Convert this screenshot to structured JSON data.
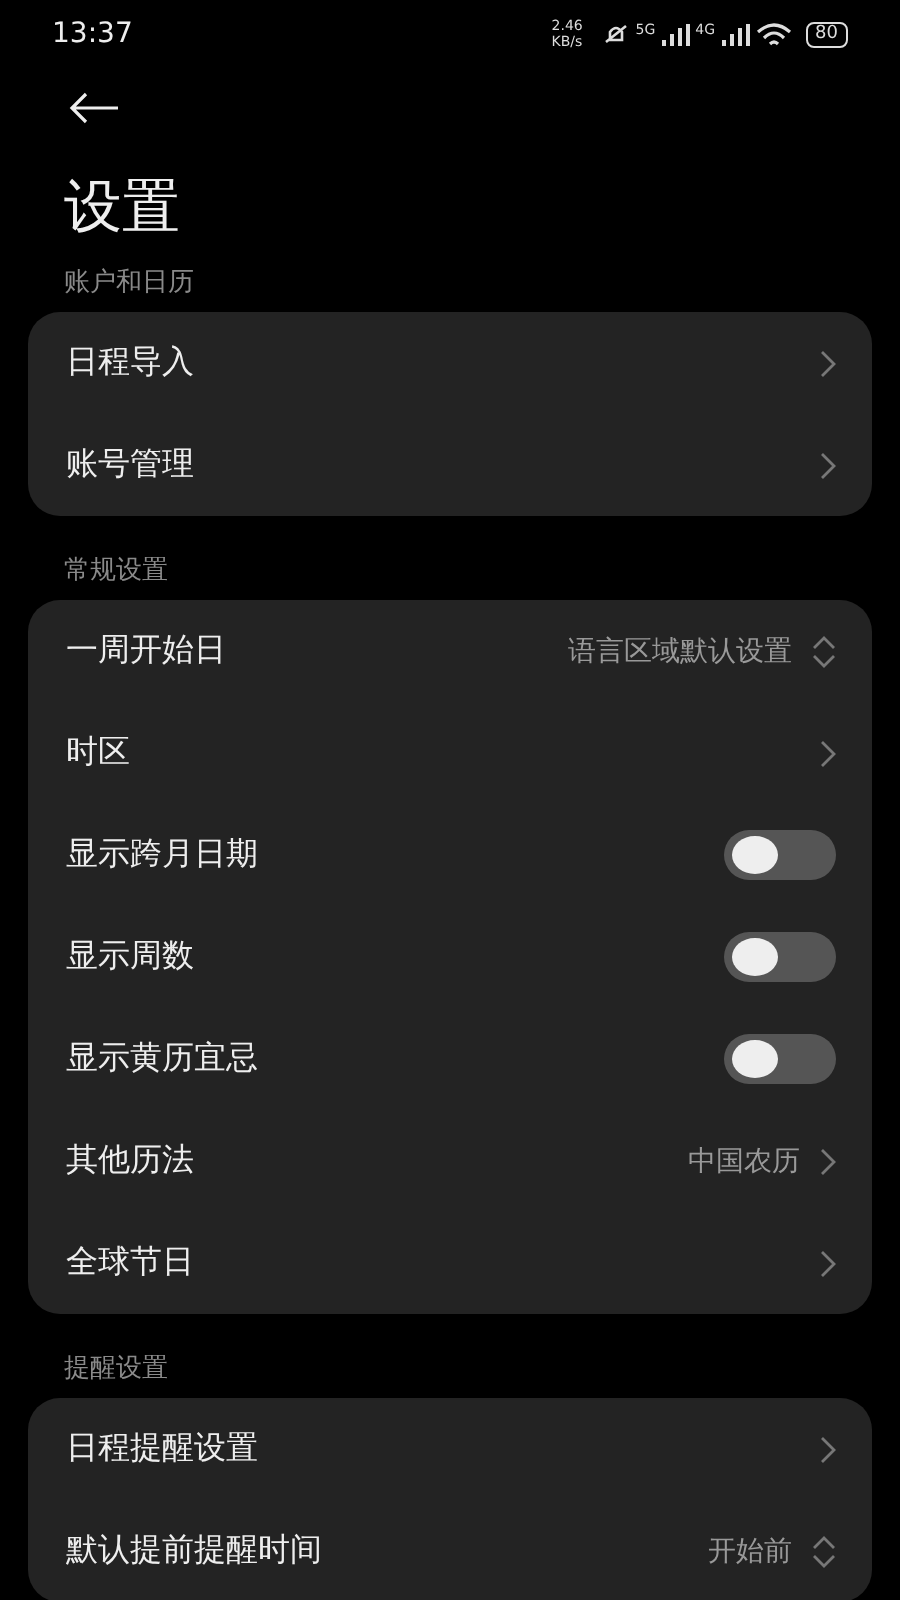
{
  "status_bar": {
    "time": "13:37",
    "speed": "2.46 KB/s",
    "networks": [
      "5G",
      "4G"
    ],
    "battery": "80"
  },
  "title": "设置",
  "sections": [
    {
      "label": "账户和日历",
      "items": [
        {
          "kind": "link",
          "label": "日程导入"
        },
        {
          "kind": "link",
          "label": "账号管理"
        }
      ]
    },
    {
      "label": "常规设置",
      "items": [
        {
          "kind": "select",
          "label": "一周开始日",
          "value": "语言区域默认设置"
        },
        {
          "kind": "link",
          "label": "时区"
        },
        {
          "kind": "toggle",
          "label": "显示跨月日期",
          "on": false
        },
        {
          "kind": "toggle",
          "label": "显示周数",
          "on": false
        },
        {
          "kind": "toggle",
          "label": "显示黄历宜忌",
          "on": false
        },
        {
          "kind": "link",
          "label": "其他历法",
          "value": "中国农历"
        },
        {
          "kind": "link",
          "label": "全球节日"
        }
      ]
    },
    {
      "label": "提醒设置",
      "items": [
        {
          "kind": "link",
          "label": "日程提醒设置"
        },
        {
          "kind": "select",
          "label": "默认提前提醒时间",
          "value": "开始前"
        }
      ]
    }
  ]
}
